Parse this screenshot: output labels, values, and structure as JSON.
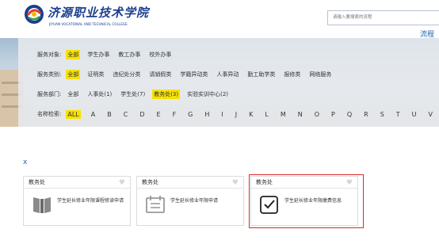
{
  "header": {
    "school_name_cn": "济源职业技术学院",
    "school_name_en": "JIYUAN VOCATIONAL AND TECHNICAL COLLEGE",
    "search_placeholder": "请输入要搜索的流程",
    "flow_link": "流程"
  },
  "filters": {
    "service_target": {
      "label": "服务对象:",
      "items": [
        "全部",
        "学生办事",
        "教工办事",
        "校外办事"
      ],
      "selected": 0
    },
    "service_category": {
      "label": "服务类别:",
      "items": [
        "全部",
        "证明类",
        "违纪处分类",
        "请销假类",
        "学籍异动类",
        "人事异动",
        "勤工助学类",
        "报修类",
        "网络服务"
      ],
      "selected": 0
    },
    "service_dept": {
      "label": "服务部门:",
      "items": [
        "全部",
        "人事处(1)",
        "学生处(7)",
        "教务处(3)",
        "实验实训中心(2)"
      ],
      "selected": 3
    },
    "name_search": {
      "label": "名称检索:",
      "items": [
        "ALL",
        "A",
        "B",
        "C",
        "D",
        "E",
        "F",
        "G",
        "H",
        "I",
        "J",
        "K",
        "L",
        "M",
        "N",
        "O",
        "P",
        "Q",
        "R",
        "S",
        "T",
        "U",
        "V",
        "W",
        "X",
        "Y",
        "Z"
      ],
      "selected": 0
    }
  },
  "close_label": "x",
  "cards": [
    {
      "dept": "教务处",
      "title": "学生延长修业年限课程修读申请",
      "icon": "book-icon"
    },
    {
      "dept": "教务处",
      "title": "学生延长修业年限申请",
      "icon": "calendar-icon"
    },
    {
      "dept": "教务处",
      "title": "学生延长修业年限缴费信息",
      "icon": "checkbox-icon"
    }
  ],
  "colors": {
    "selected_bg": "#f7e100",
    "brand_blue": "#1b3f8f",
    "link_blue": "#1d61b6",
    "highlight_red": "#d92b2b"
  }
}
